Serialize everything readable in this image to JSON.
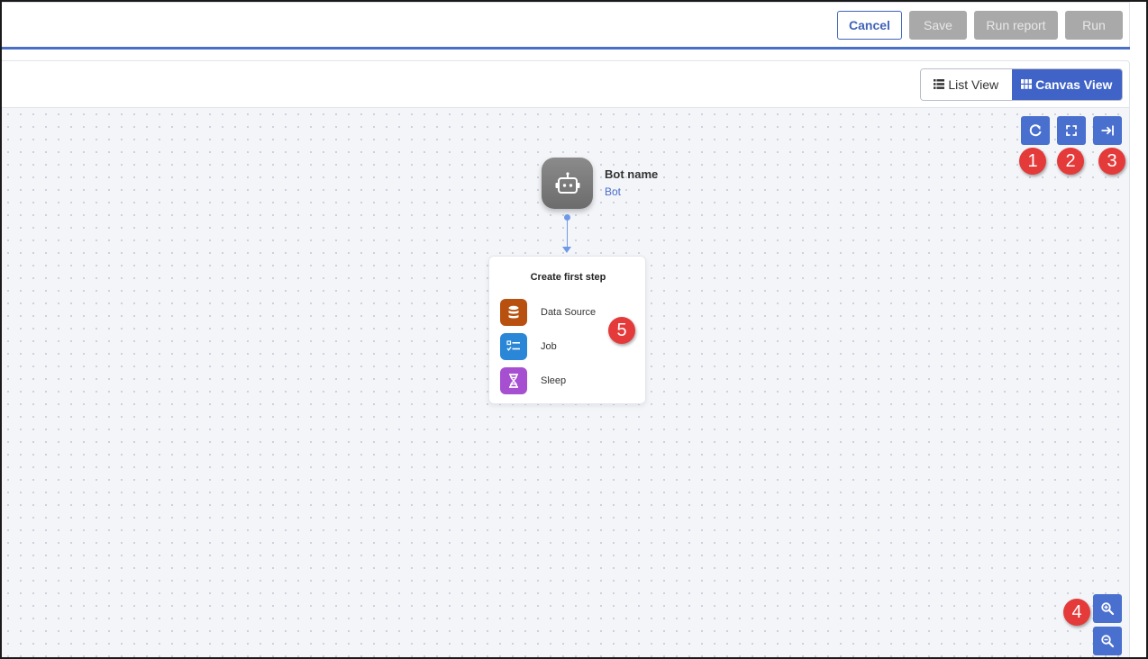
{
  "toolbar": {
    "cancel_label": "Cancel",
    "save_label": "Save",
    "run_report_label": "Run report",
    "run_label": "Run"
  },
  "view_toggle": {
    "list_view_label": "List View",
    "canvas_view_label": "Canvas View",
    "selected": "Canvas View"
  },
  "canvas": {
    "controls": [
      {
        "name": "refresh-icon",
        "badge": "1"
      },
      {
        "name": "fit-screen-icon",
        "badge": "2"
      },
      {
        "name": "collapse-panel-icon",
        "badge": "3"
      }
    ],
    "zoom": {
      "zoom_in": "zoom-in-icon",
      "zoom_out": "zoom-out-icon",
      "badge": "4"
    },
    "bot": {
      "name": "Bot name",
      "type": "Bot",
      "icon": "robot-icon"
    },
    "first_step": {
      "title": "Create first step",
      "badge": "5",
      "items": [
        {
          "label": "Data Source",
          "icon": "database-icon",
          "color": "#b8500f"
        },
        {
          "label": "Job",
          "icon": "checklist-icon",
          "color": "#2a86d6"
        },
        {
          "label": "Sleep",
          "icon": "hourglass-icon",
          "color": "#a64fd1"
        }
      ]
    }
  },
  "colors": {
    "accent": "#4a6fc9",
    "badge": "#e43a3a",
    "disabled": "#a9a9a9"
  }
}
